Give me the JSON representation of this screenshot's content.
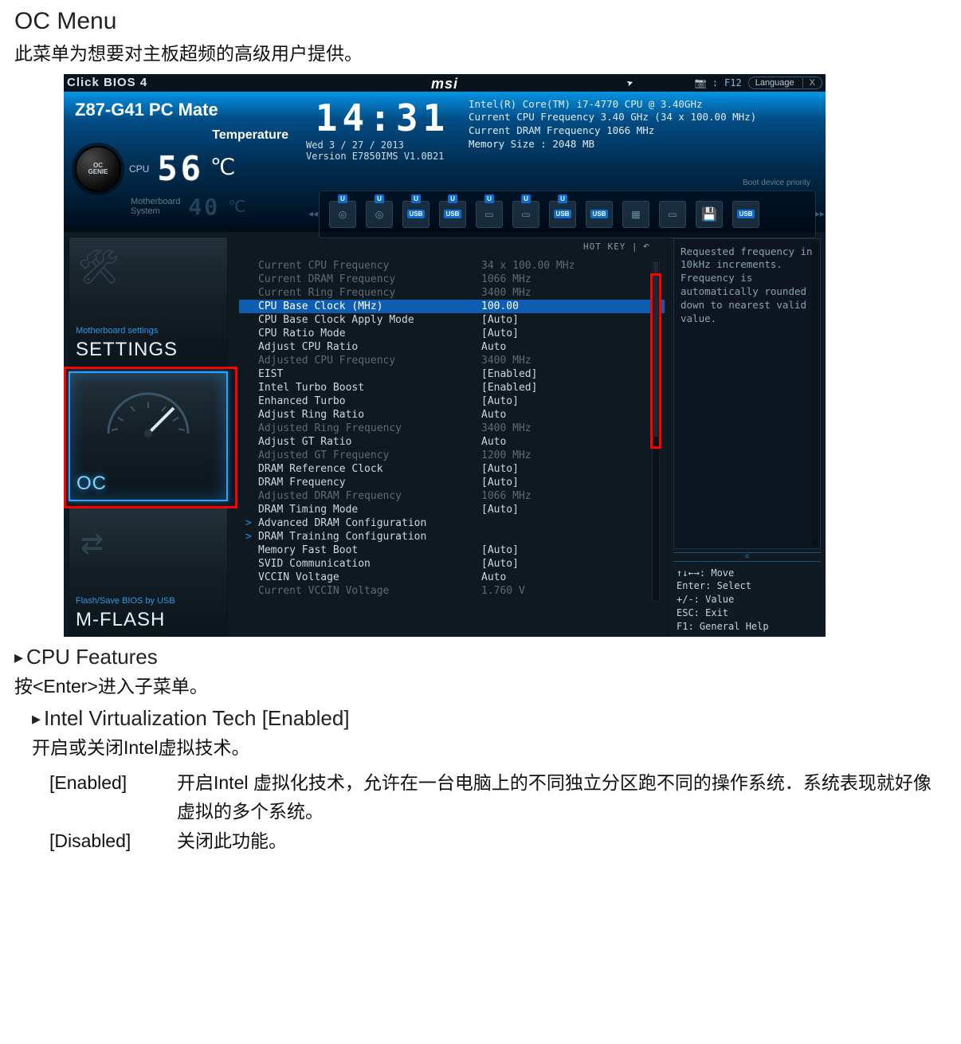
{
  "doc": {
    "title": "OC Menu",
    "intro": "此菜单为想要对主板超频的高级用户提供。",
    "feature_heading": "CPU Features",
    "feature_enter": "按<Enter>进入子菜单。",
    "virt_heading": "Intel Virtualization Tech [Enabled]",
    "virt_desc": "开启或关闭Intel虚拟技术。",
    "enabled_key": "[Enabled]",
    "enabled_val": "开启Intel 虚拟化技术，允许在一台电脑上的不同独立分区跑不同的操作系统．系统表现就好像虚拟的多个系统。",
    "disabled_key": "[Disabled]",
    "disabled_val": "关闭此功能。"
  },
  "topbar": {
    "brand": "Click BIOS 4",
    "logo": "msi",
    "f12": "F12",
    "language": "Language",
    "x": "X"
  },
  "header": {
    "board": "Z87-G41 PC Mate",
    "temp_label": "Temperature",
    "cpu_label": "CPU",
    "cpu_temp": "56",
    "mb_label": "Motherboard\nSystem",
    "mb_temp": "40",
    "deg": "℃",
    "clock": "14:31",
    "date": "Wed  3 / 27 / 2013",
    "version": "Version E7850IMS V1.0B21",
    "info1": "Intel(R) Core(TM) i7-4770 CPU @ 3.40GHz",
    "info2": "Current CPU Frequency 3.40 GHz (34 x 100.00 MHz)",
    "info3": "Current DRAM Frequency 1066 MHz",
    "info4": "Memory Size : 2048 MB",
    "boot_label": "Boot device priority",
    "oc_genie": "OC\nGENIE"
  },
  "sidebar": {
    "settings_super": "Motherboard settings",
    "settings": "SETTINGS",
    "oc": "OC",
    "mflash_super": "Flash/Save BIOS by USB",
    "mflash": "M-FLASH"
  },
  "hotkey": "HOT KEY |",
  "settings_rows": [
    {
      "k": "Current CPU Frequency",
      "v": "34 x 100.00 MHz",
      "dim": true
    },
    {
      "k": "Current DRAM Frequency",
      "v": "1066 MHz",
      "dim": true
    },
    {
      "k": "Current Ring Frequency",
      "v": "3400 MHz",
      "dim": true
    },
    {
      "k": "CPU Base Clock (MHz)",
      "v": "100.00",
      "selected": true
    },
    {
      "k": "CPU Base Clock Apply Mode",
      "v": "[Auto]"
    },
    {
      "k": "CPU Ratio Mode",
      "v": "[Auto]"
    },
    {
      "k": "Adjust CPU Ratio",
      "v": "Auto"
    },
    {
      "k": "Adjusted CPU Frequency",
      "v": "3400 MHz",
      "dim": true
    },
    {
      "k": "EIST",
      "v": "[Enabled]"
    },
    {
      "k": "Intel Turbo Boost",
      "v": "[Enabled]"
    },
    {
      "k": "Enhanced Turbo",
      "v": "[Auto]"
    },
    {
      "k": "Adjust Ring Ratio",
      "v": "Auto"
    },
    {
      "k": "Adjusted Ring Frequency",
      "v": "3400 MHz",
      "dim": true
    },
    {
      "k": "Adjust GT Ratio",
      "v": "Auto"
    },
    {
      "k": "Adjusted GT Frequency",
      "v": "1200 MHz",
      "dim": true
    },
    {
      "k": "DRAM Reference Clock",
      "v": "[Auto]"
    },
    {
      "k": "DRAM Frequency",
      "v": "[Auto]"
    },
    {
      "k": "Adjusted DRAM Frequency",
      "v": "1066 MHz",
      "dim": true
    },
    {
      "k": "DRAM Timing Mode",
      "v": "[Auto]"
    },
    {
      "k": "Advanced DRAM Configuration",
      "v": "",
      "submenu": true
    },
    {
      "k": "DRAM Training Configuration",
      "v": "",
      "submenu": true
    },
    {
      "k": "Memory Fast Boot",
      "v": "[Auto]"
    },
    {
      "k": "SVID Communication",
      "v": "[Auto]"
    },
    {
      "k": "VCCIN Voltage",
      "v": "Auto"
    },
    {
      "k": "Current VCCIN Voltage",
      "v": "1.760 V",
      "dim": true
    }
  ],
  "help": "Requested frequency in 10kHz increments. Frequency is automatically rounded down to nearest valid value.",
  "hints": {
    "move": "↑↓←→: Move",
    "enter": "Enter: Select",
    "plusminus": "+/-: Value",
    "esc": "ESC: Exit",
    "f1": "F1: General Help"
  }
}
